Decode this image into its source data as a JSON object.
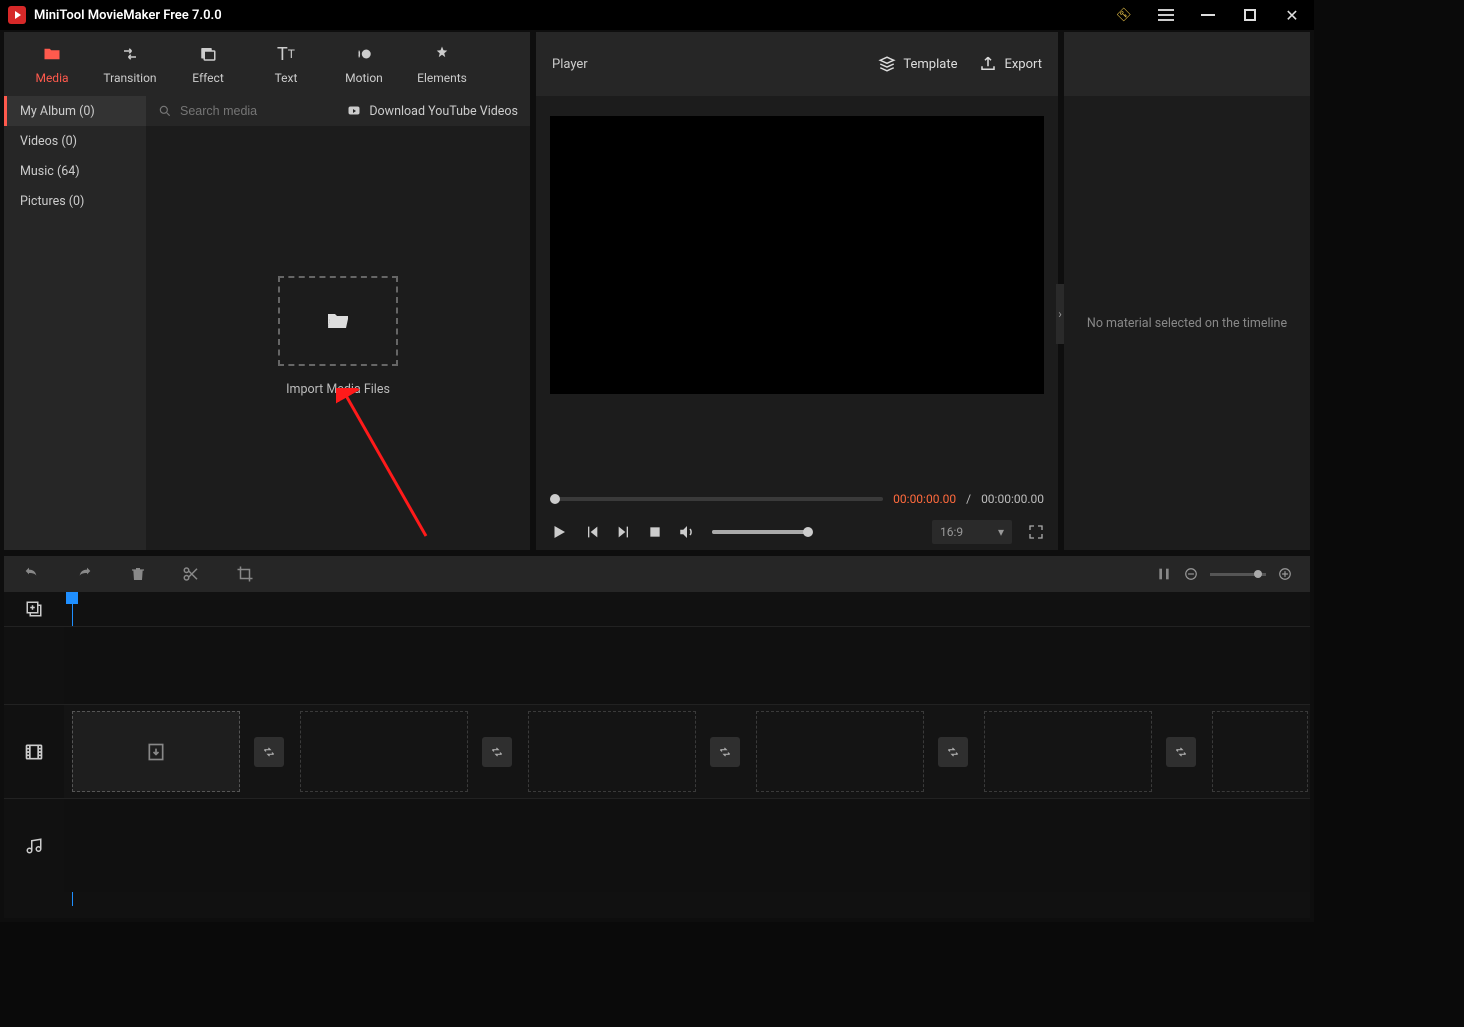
{
  "title": "MiniTool MovieMaker Free 7.0.0",
  "tabs": {
    "media": "Media",
    "transition": "Transition",
    "effect": "Effect",
    "text": "Text",
    "motion": "Motion",
    "elements": "Elements"
  },
  "sidebar": {
    "items": [
      {
        "label": "My Album (0)"
      },
      {
        "label": "Videos (0)"
      },
      {
        "label": "Music (64)"
      },
      {
        "label": "Pictures (0)"
      }
    ]
  },
  "search": {
    "placeholder": "Search media"
  },
  "download_youtube": "Download YouTube Videos",
  "import_label": "Import Media Files",
  "player": {
    "title": "Player",
    "template_label": "Template",
    "export_label": "Export",
    "time_current": "00:00:00.00",
    "time_duration": "00:00:00.00",
    "time_separator": "/",
    "aspect_ratio": "16:9"
  },
  "inspector": {
    "empty": "No material selected on the timeline"
  }
}
